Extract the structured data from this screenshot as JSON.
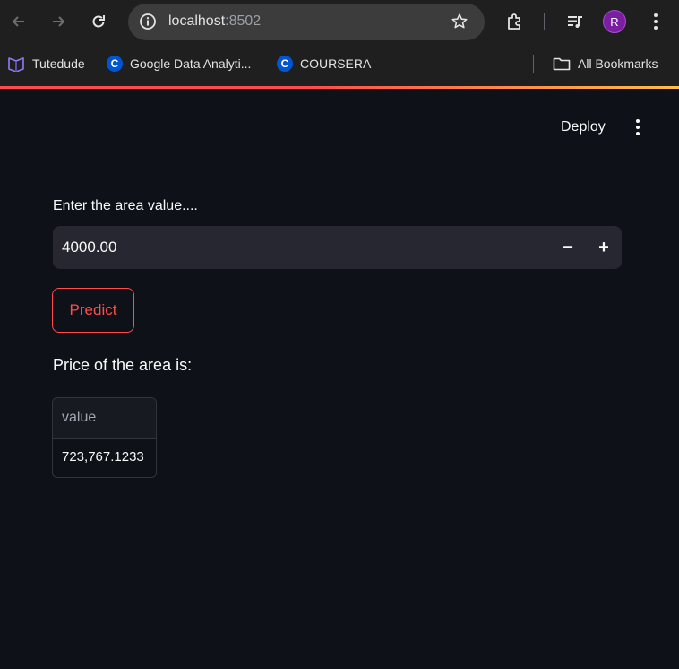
{
  "browser": {
    "url_host": "localhost",
    "url_port": ":8502",
    "profile_initial": "R",
    "bookmarks": [
      {
        "label": "Tutedude",
        "icon": "tutedude-icon"
      },
      {
        "label": "Google Data Analyti...",
        "icon": "coursera-icon"
      },
      {
        "label": "COURSERA",
        "icon": "coursera-icon"
      }
    ],
    "all_bookmarks_label": "All Bookmarks",
    "coursera_glyph": "C"
  },
  "app": {
    "deploy_label": "Deploy",
    "input": {
      "label": "Enter the area value....",
      "value": "4000.00",
      "minus": "−",
      "plus": "+"
    },
    "predict_label": "Predict",
    "result_text": "Price of the area is:",
    "dataframe": {
      "column": "value",
      "rows": [
        "723,767.1233"
      ]
    }
  },
  "colors": {
    "accent": "#ff4b4b",
    "background": "#0e1117",
    "input_bg": "#262730",
    "avatar": "#7b1fa2"
  }
}
